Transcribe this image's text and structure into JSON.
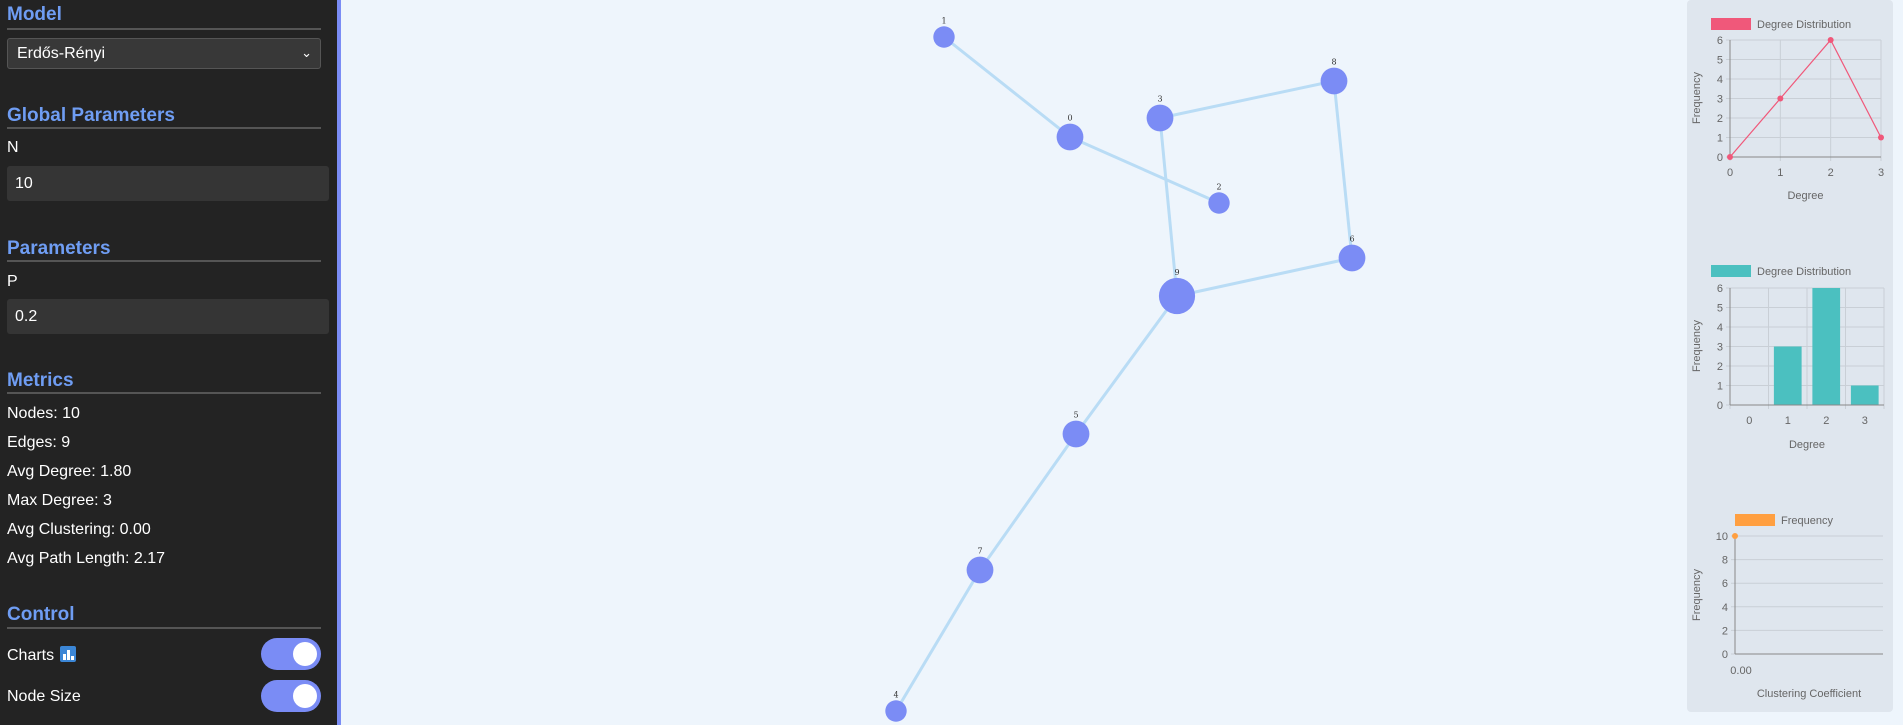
{
  "sidebar": {
    "model": {
      "title": "Model",
      "selected": "Erdős-Rényi"
    },
    "global": {
      "title": "Global Parameters",
      "n_label": "N",
      "n_value": "10"
    },
    "params": {
      "title": "Parameters",
      "p_label": "P",
      "p_value": "0.2"
    },
    "metrics": {
      "title": "Metrics",
      "nodes": "Nodes: 10",
      "edges": "Edges: 9",
      "avg_degree": "Avg Degree: 1.80",
      "max_degree": "Max Degree: 3",
      "avg_clustering": "Avg Clustering: 0.00",
      "avg_path": "Avg Path Length: 2.17"
    },
    "control": {
      "title": "Control",
      "charts_label": "Charts",
      "charts_icon": "bar-chart-icon",
      "charts_on": true,
      "node_size_label": "Node Size",
      "node_size_on": true
    }
  },
  "graph": {
    "node_color": "#7b8cf5",
    "edge_color": "#b9dcf5",
    "nodes": [
      {
        "id": "0",
        "degree": 2
      },
      {
        "id": "1",
        "degree": 1
      },
      {
        "id": "2",
        "degree": 1
      },
      {
        "id": "3",
        "degree": 2
      },
      {
        "id": "4",
        "degree": 1
      },
      {
        "id": "5",
        "degree": 2
      },
      {
        "id": "6",
        "degree": 2
      },
      {
        "id": "7",
        "degree": 2
      },
      {
        "id": "8",
        "degree": 2
      },
      {
        "id": "9",
        "degree": 3
      }
    ],
    "edges": [
      [
        "1",
        "0"
      ],
      [
        "0",
        "2"
      ],
      [
        "3",
        "8"
      ],
      [
        "3",
        "9"
      ],
      [
        "8",
        "6"
      ],
      [
        "6",
        "9"
      ],
      [
        "9",
        "5"
      ],
      [
        "5",
        "7"
      ],
      [
        "7",
        "4"
      ]
    ]
  },
  "chart_data": [
    {
      "type": "line",
      "legend": "Degree Distribution",
      "color": "#f0587a",
      "x": [
        0,
        1,
        2,
        3
      ],
      "y": [
        0,
        3,
        6,
        1
      ],
      "xlabel": "Degree",
      "ylabel": "Frequency",
      "ylim": [
        0,
        6
      ],
      "yticks": [
        "0",
        "1",
        "2",
        "3",
        "4",
        "5",
        "6"
      ],
      "xticks": [
        "0",
        "1",
        "2",
        "3"
      ]
    },
    {
      "type": "bar",
      "legend": "Degree Distribution",
      "color": "#4bc0c0",
      "categories": [
        "0",
        "1",
        "2",
        "3"
      ],
      "values": [
        0,
        3,
        6,
        1
      ],
      "xlabel": "Degree",
      "ylabel": "Frequency",
      "ylim": [
        0,
        6
      ],
      "yticks": [
        "0",
        "1",
        "2",
        "3",
        "4",
        "5",
        "6"
      ]
    },
    {
      "type": "scatter",
      "legend": "Frequency",
      "color": "#ff9f40",
      "x": [
        0.0
      ],
      "y": [
        10
      ],
      "xlabel": "Clustering Coefficient",
      "ylabel": "Frequency",
      "ylim": [
        0,
        10
      ],
      "yticks": [
        "0",
        "2",
        "4",
        "6",
        "8",
        "10"
      ],
      "xticks": [
        "0.00"
      ]
    }
  ]
}
